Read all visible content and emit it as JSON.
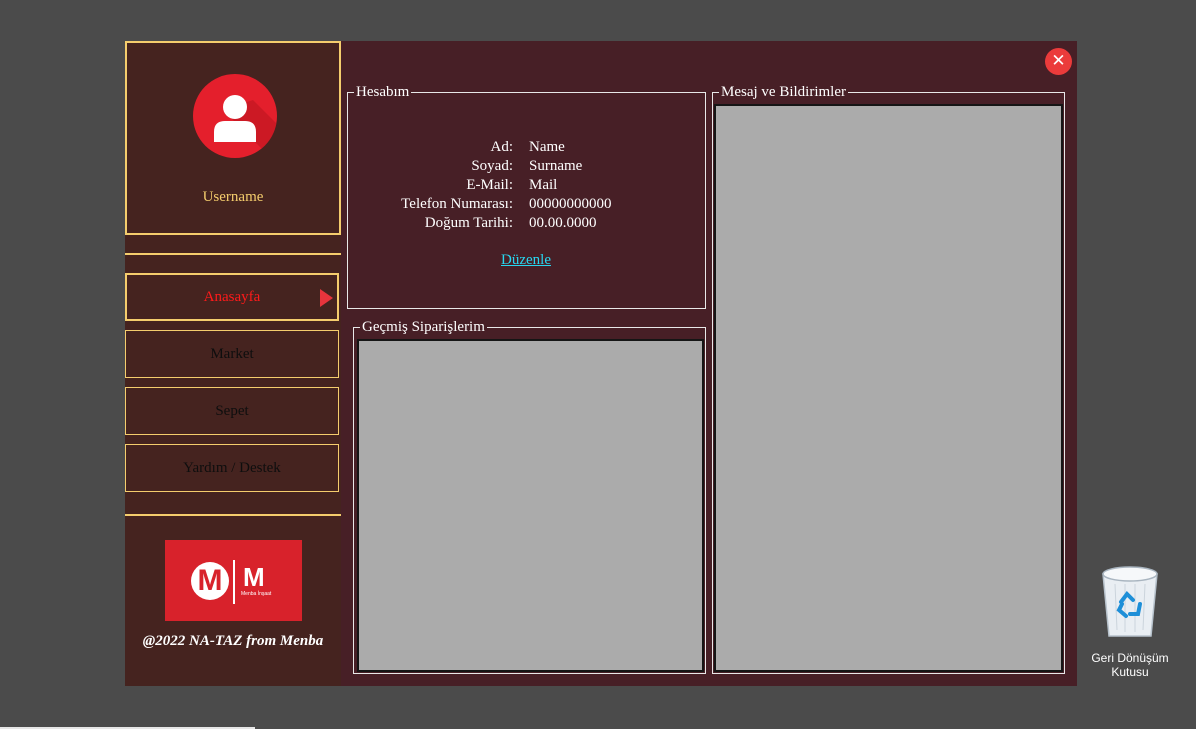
{
  "sidebar": {
    "username": "Username",
    "nav": [
      {
        "label": "Anasayfa",
        "active": true
      },
      {
        "label": "Market",
        "active": false
      },
      {
        "label": "Sepet",
        "active": false
      },
      {
        "label": "Yardım / Destek",
        "active": false
      }
    ],
    "logo": {
      "left_letter": "M",
      "right_letter": "M",
      "subtitle": "Menba İnşaat"
    },
    "copyright": "@2022 NA-TAZ from Menba"
  },
  "close_button": {
    "glyph": "✕"
  },
  "account": {
    "title": "Hesabım",
    "fields": [
      {
        "label": "Ad:",
        "value": "Name"
      },
      {
        "label": "Soyad:",
        "value": "Surname"
      },
      {
        "label": "E-Mail:",
        "value": "Mail"
      },
      {
        "label": "Telefon Numarası:",
        "value": "00000000000"
      },
      {
        "label": "Doğum Tarihi:",
        "value": "00.00.0000"
      }
    ],
    "edit_link": "Düzenle"
  },
  "orders": {
    "title": "Geçmiş Siparişlerim"
  },
  "messages": {
    "title": "Mesaj ve Bildirimler"
  },
  "desktop": {
    "recycle_bin_label_line1": "Geri Dönüşüm",
    "recycle_bin_label_line2": "Kutusu"
  },
  "colors": {
    "desktop_bg": "#4b4b4b",
    "window_bg": "#471f26",
    "sidebar_bg": "#45231f",
    "accent_gold": "#f5cd6d",
    "active_red": "#ff1a1a",
    "link_cyan": "#27d7f0",
    "list_gray": "#ababab",
    "logo_red": "#d8222b"
  }
}
